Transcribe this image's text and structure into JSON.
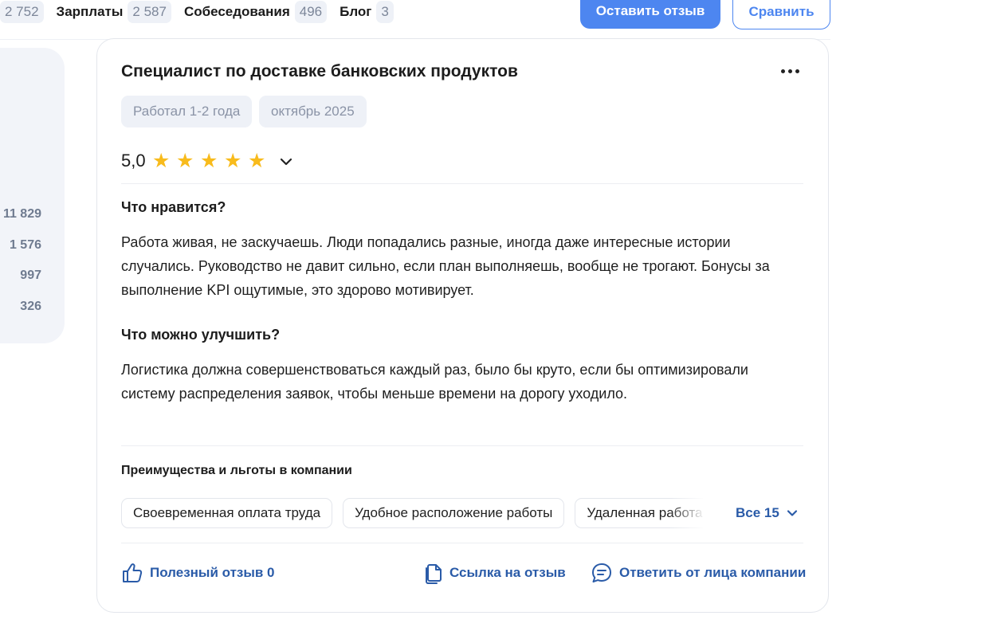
{
  "topnav": {
    "first_count": "2 752",
    "items": [
      {
        "label": "Зарплаты",
        "count": "2 587"
      },
      {
        "label": "Собеседования",
        "count": "496"
      },
      {
        "label": "Блог",
        "count": "3"
      }
    ],
    "leave_review_label": "Оставить отзыв",
    "compare_label": "Сравнить"
  },
  "side_stats": [
    "11 829",
    "1 576",
    "997",
    "326"
  ],
  "review": {
    "title": "Специалист по доставке банковских продуктов",
    "tags": [
      "Работал 1-2 года",
      "октябрь 2025"
    ],
    "rating": "5,0",
    "stars": 5,
    "likes_heading": "Что нравится?",
    "likes_text": "Работа живая, не заскучаешь. Люди попадались разные, иногда даже интересные истории случались. Руководство не давит сильно, если план выполняешь, вообще не трогают. Бонусы за выполнение KPI ощутимые, это здорово мотивирует.",
    "improve_heading": "Что можно улучшить?",
    "improve_text": "Логистика должна совершенствоваться каждый раз, было бы круто, если бы оптимизировали систему распределения заявок, чтобы меньше времени на дорогу уходило.",
    "benefits_heading": "Преимущества и льготы в компании",
    "benefits": [
      "Своевременная оплата труда",
      "Удобное расположение работы",
      "Удаленная работа"
    ],
    "all_benefits_label": "Все 15",
    "actions": {
      "useful": "Полезный отзыв 0",
      "link": "Ссылка на отзыв",
      "reply": "Ответить от лица компании"
    }
  },
  "colors": {
    "accent": "#4d86f0",
    "link": "#2a5ba8",
    "star": "#f8bb1c",
    "chip_bg": "#eef1f7"
  }
}
